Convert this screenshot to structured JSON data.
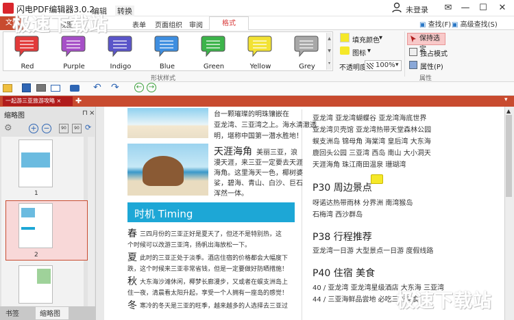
{
  "window": {
    "title": "闪电PDF编辑器3.0.2",
    "edit_label": "编辑",
    "convert_label": "转换",
    "login": "未登录"
  },
  "ribbon_tabs": [
    "文件",
    "视图",
    "表单",
    "页面组织",
    "审阅",
    "格式"
  ],
  "ribbon_tools": {
    "find": "查找(F)",
    "advanced_find": "高级查找(S)"
  },
  "swatches": [
    {
      "label": "Red",
      "color": "#e23a3a"
    },
    {
      "label": "Purple",
      "color": "#a64fc7"
    },
    {
      "label": "Indigo",
      "color": "#5a55c9"
    },
    {
      "label": "Blue",
      "color": "#3e8ee0"
    },
    {
      "label": "Green",
      "color": "#3cb44a"
    },
    {
      "label": "Yellow",
      "color": "#f2e234"
    },
    {
      "label": "Grey",
      "color": "#a8a8a8"
    }
  ],
  "shape_style_group": "形状样式",
  "format_panel": {
    "fill_color": "填充颜色",
    "icon": "图标",
    "opacity_label": "不透明度:",
    "opacity_value": "100%",
    "keep_selection": "保持选定",
    "exclusive_mode": "独占模式",
    "properties": "属性(P)",
    "properties_group": "属性"
  },
  "document_tab": "一起游三亚旅游攻略",
  "left_panel": {
    "title": "缩略图",
    "page1": "1",
    "page2": "2",
    "tab_bookmarks": "书签",
    "tab_thumbnails": "缩略图"
  },
  "doc": {
    "left_top_lines": [
      "台一颗璀璨的明珠镶嵌在",
      "亚龙湾、三亚湾之上。海水清澈透",
      "明，堪称中国第一潜水胜地！"
    ],
    "tianya_heading": "天涯海角",
    "tianya_lines": [
      "美丽三亚，浪",
      "漫天涯，来三亚一定要去天涯",
      "海角。这里海天一色，椰树婆",
      "娑，碧海、青山、白沙、巨石",
      "浑然一体。"
    ],
    "timing_title": "时机 Timing",
    "season_lines": [
      {
        "big": "春",
        "text": "三四月份的三亚正好是夏天了，但还不是特别热，这"
      },
      {
        "big": "",
        "text": "个时候可以改游三亚湾，扬帆出海放松一下。"
      },
      {
        "big": "夏",
        "text": "此时的三亚正处于淡季。酒店住宿的价格都会大幅度下"
      },
      {
        "big": "",
        "text": "跌，这个时候来三亚非常省钱，但是一定要做好防晒措施！"
      },
      {
        "big": "秋",
        "text": "大东海沙滩休闲，椰梦长廊漫步，又或者在蜈支洲岛上"
      },
      {
        "big": "",
        "text": "住一夜，清晨看太阳升起，享受一个人拥有一座岛的感觉！"
      },
      {
        "big": "冬",
        "text": "寒冷的冬天是三亚的旺季，越来越多的人选择去三亚过"
      }
    ],
    "right_lines": [
      "亚龙湾    亚龙湾蝴蝶谷    亚龙湾海底世界",
      "亚龙湾贝壳馆    亚龙湾热带天堂森林公园",
      "蜈支洲岛    锦母角    海棠湾    皇后湾    大东海",
      "鹿回头公园    三亚湾    西岛    南山    大小洞天",
      "天涯海角    珠江南田温泉    珊瑚湾"
    ],
    "p30": "P30 周边景点",
    "p30_lines": [
      "呀诺达热带雨林    分界洲    南湾猴岛",
      "石梅湾    西沙群岛"
    ],
    "p38": "P38 行程推荐",
    "p38_line": "亚龙湾一日游    大型景点一日游    度假线路",
    "p40": "P40 住宿 美食",
    "p40_lines": [
      "40 / 亚龙湾    亚龙湾星级酒店    大东海    三亚湾",
      "44 / 三亚海鲜品尝地    必吃三亚美食"
    ]
  },
  "watermark": "极速下载站",
  "colors": {
    "accent": "#c84b2f",
    "tab_red": "#b01c1c",
    "timing": "#1da7d6"
  }
}
